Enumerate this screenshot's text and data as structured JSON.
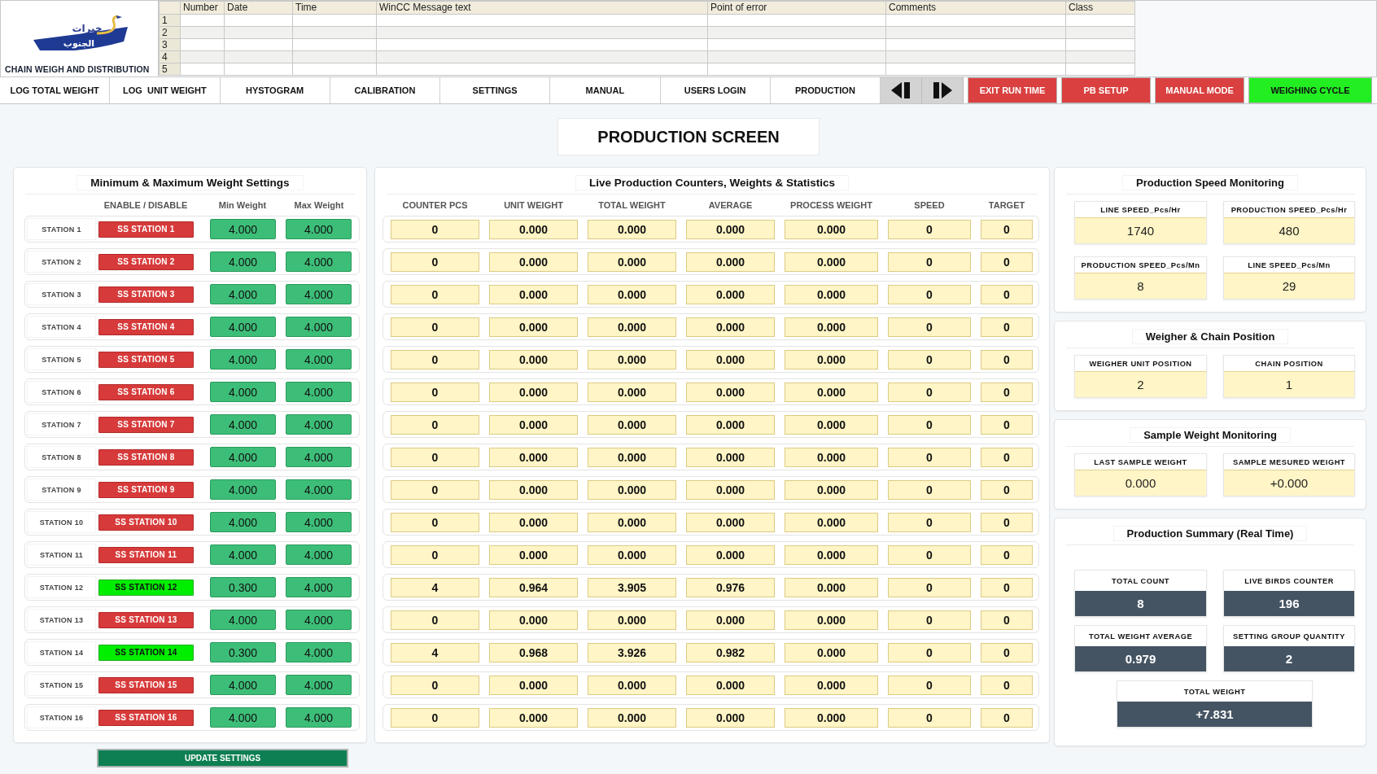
{
  "header": {
    "logo_text": [
      "خيرات",
      "الجنوب"
    ],
    "subtitle": "CHAIN WEIGH AND DISTRIBUTION"
  },
  "message_table": {
    "columns": [
      "Number",
      "Date",
      "Time",
      "WinCC Message text",
      "Point of error",
      "Comments",
      "Class"
    ],
    "rows": [
      "1",
      "2",
      "3",
      "4",
      "5"
    ]
  },
  "nav": {
    "tabs": [
      "LOG TOTAL WEIGHT",
      "LOG  UNIT WEIGHT",
      "HYSTOGRAM",
      "CALIBRATION",
      "SETTINGS",
      "MANUAL",
      "USERS LOGIN",
      "PRODUCTION"
    ],
    "arrows": [
      {
        "kind": "previous"
      },
      {
        "kind": "next"
      }
    ],
    "actions": [
      {
        "label": "EXIT RUN TIME",
        "on": false
      },
      {
        "label": "PB SETUP",
        "on": false
      },
      {
        "label": "MANUAL MODE",
        "on": false
      },
      {
        "label": "WEIGHING CYCLE",
        "on": true
      }
    ]
  },
  "screen_title": "PRODUCTION SCREEN",
  "weight_settings": {
    "title": "Minimum & Maximum Weight Settings",
    "columns": [
      "ENABLE / DISABLE",
      "Min Weight",
      "Max Weight"
    ],
    "stations": [
      {
        "name": "STATION 1",
        "button": "SS STATION 1",
        "enabled": false,
        "min_weight": "4.000",
        "max_weight": "4.000"
      },
      {
        "name": "STATION 2",
        "button": "SS STATION 2",
        "enabled": false,
        "min_weight": "4.000",
        "max_weight": "4.000"
      },
      {
        "name": "STATION 3",
        "button": "SS STATION 3",
        "enabled": false,
        "min_weight": "4.000",
        "max_weight": "4.000"
      },
      {
        "name": "STATION 4",
        "button": "SS STATION 4",
        "enabled": false,
        "min_weight": "4.000",
        "max_weight": "4.000"
      },
      {
        "name": "STATION 5",
        "button": "SS STATION 5",
        "enabled": false,
        "min_weight": "4.000",
        "max_weight": "4.000"
      },
      {
        "name": "STATION 6",
        "button": "SS STATION 6",
        "enabled": false,
        "min_weight": "4.000",
        "max_weight": "4.000"
      },
      {
        "name": "STATION 7",
        "button": "SS STATION 7",
        "enabled": false,
        "min_weight": "4.000",
        "max_weight": "4.000"
      },
      {
        "name": "STATION 8",
        "button": "SS STATION 8",
        "enabled": false,
        "min_weight": "4.000",
        "max_weight": "4.000"
      },
      {
        "name": "STATION 9",
        "button": "SS STATION 9",
        "enabled": false,
        "min_weight": "4.000",
        "max_weight": "4.000"
      },
      {
        "name": "STATION 10",
        "button": "SS STATION 10",
        "enabled": false,
        "min_weight": "4.000",
        "max_weight": "4.000"
      },
      {
        "name": "STATION 11",
        "button": "SS STATION 11",
        "enabled": false,
        "min_weight": "4.000",
        "max_weight": "4.000"
      },
      {
        "name": "STATION 12",
        "button": "SS STATION 12",
        "enabled": true,
        "min_weight": "0.300",
        "max_weight": "4.000"
      },
      {
        "name": "STATION 13",
        "button": "SS STATION 13",
        "enabled": false,
        "min_weight": "4.000",
        "max_weight": "4.000"
      },
      {
        "name": "STATION 14",
        "button": "SS STATION 14",
        "enabled": true,
        "min_weight": "0.300",
        "max_weight": "4.000"
      },
      {
        "name": "STATION 15",
        "button": "SS STATION 15",
        "enabled": false,
        "min_weight": "4.000",
        "max_weight": "4.000"
      },
      {
        "name": "STATION 16",
        "button": "SS STATION 16",
        "enabled": false,
        "min_weight": "4.000",
        "max_weight": "4.000"
      }
    ],
    "update_button": "UPDATE SETTINGS"
  },
  "live_production": {
    "title": "Live Production Counters, Weights & Statistics",
    "columns": [
      "COUNTER PCS",
      "UNIT WEIGHT",
      "TOTAL WEIGHT",
      "AVERAGE",
      "PROCESS WEIGHT",
      "SPEED",
      "TARGET"
    ],
    "rows": [
      [
        "0",
        "0.000",
        "0.000",
        "0.000",
        "0.000",
        "0",
        "0"
      ],
      [
        "0",
        "0.000",
        "0.000",
        "0.000",
        "0.000",
        "0",
        "0"
      ],
      [
        "0",
        "0.000",
        "0.000",
        "0.000",
        "0.000",
        "0",
        "0"
      ],
      [
        "0",
        "0.000",
        "0.000",
        "0.000",
        "0.000",
        "0",
        "0"
      ],
      [
        "0",
        "0.000",
        "0.000",
        "0.000",
        "0.000",
        "0",
        "0"
      ],
      [
        "0",
        "0.000",
        "0.000",
        "0.000",
        "0.000",
        "0",
        "0"
      ],
      [
        "0",
        "0.000",
        "0.000",
        "0.000",
        "0.000",
        "0",
        "0"
      ],
      [
        "0",
        "0.000",
        "0.000",
        "0.000",
        "0.000",
        "0",
        "0"
      ],
      [
        "0",
        "0.000",
        "0.000",
        "0.000",
        "0.000",
        "0",
        "0"
      ],
      [
        "0",
        "0.000",
        "0.000",
        "0.000",
        "0.000",
        "0",
        "0"
      ],
      [
        "0",
        "0.000",
        "0.000",
        "0.000",
        "0.000",
        "0",
        "0"
      ],
      [
        "4",
        "0.964",
        "3.905",
        "0.976",
        "0.000",
        "0",
        "0"
      ],
      [
        "0",
        "0.000",
        "0.000",
        "0.000",
        "0.000",
        "0",
        "0"
      ],
      [
        "4",
        "0.968",
        "3.926",
        "0.982",
        "0.000",
        "0",
        "0"
      ],
      [
        "0",
        "0.000",
        "0.000",
        "0.000",
        "0.000",
        "0",
        "0"
      ],
      [
        "0",
        "0.000",
        "0.000",
        "0.000",
        "0.000",
        "0",
        "0"
      ]
    ]
  },
  "monitors": [
    {
      "title": "Production Speed Monitoring",
      "kind": "readout",
      "cards": [
        {
          "label": "LINE SPEED_Pcs/Hr",
          "value": "1740"
        },
        {
          "label": "PRODUCTION SPEED_Pcs/Hr",
          "value": "480"
        },
        {
          "label": "PRODUCTION SPEED_Pcs/Mn",
          "value": "8"
        },
        {
          "label": "LINE SPEED_Pcs/Mn",
          "value": "29"
        }
      ]
    },
    {
      "title": "Weigher & Chain Position",
      "kind": "readout",
      "cards": [
        {
          "label": "WEIGHER UNIT POSITION",
          "value": "2"
        },
        {
          "label": "CHAIN POSITION",
          "value": "1"
        }
      ]
    },
    {
      "title": "Sample Weight Monitoring",
      "kind": "readout",
      "cards": [
        {
          "label": "LAST SAMPLE WEIGHT",
          "value": "0.000"
        },
        {
          "label": "SAMPLE MESURED WEIGHT",
          "value": "+0.000"
        }
      ]
    },
    {
      "title": "Production Summary (Real Time)",
      "kind": "summary",
      "cards": [
        {
          "label": "TOTAL COUNT",
          "value": "8"
        },
        {
          "label": "LIVE BIRDS COUNTER",
          "value": "196"
        },
        {
          "label": "TOTAL WEIGHT AVERAGE",
          "value": "0.979"
        },
        {
          "label": "SETTING GROUP QUANTITY",
          "value": "2"
        },
        {
          "label": "TOTAL WEIGHT",
          "value": "+7.831"
        }
      ]
    }
  ]
}
